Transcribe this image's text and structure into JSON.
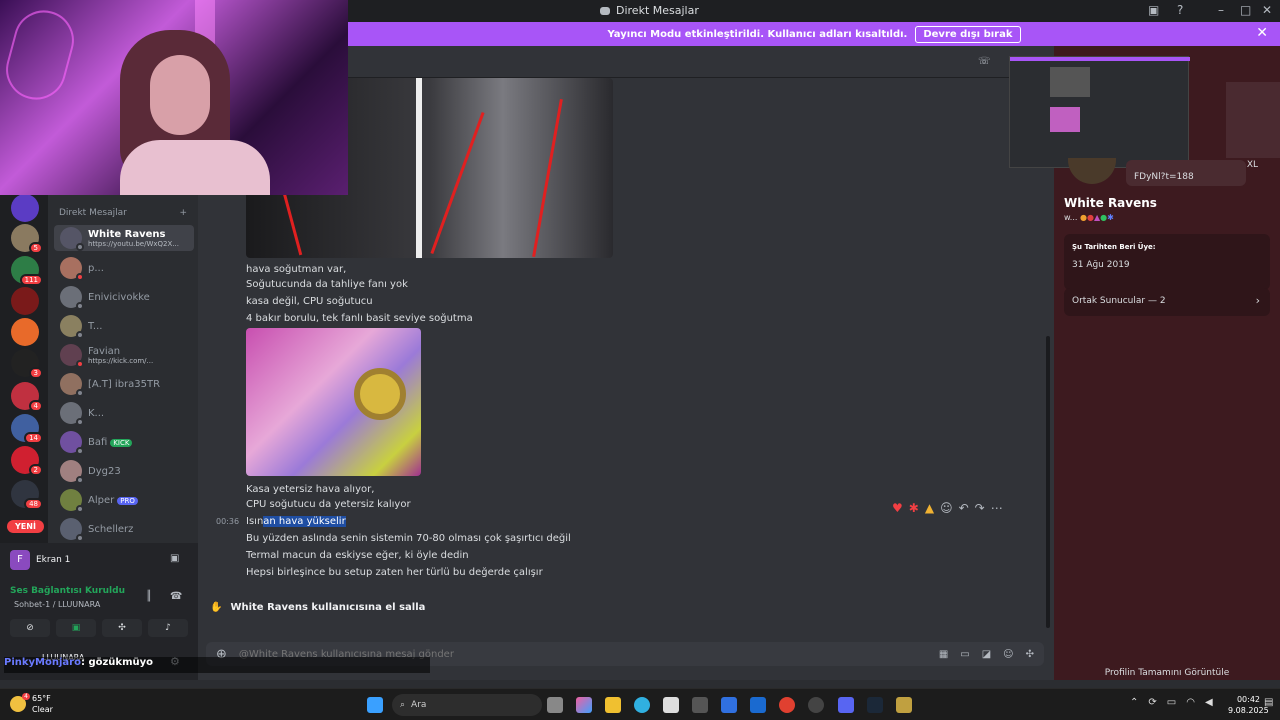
{
  "titlebar": {
    "title": "Direkt Mesajlar"
  },
  "banner": {
    "text": "Yayıncı Modu etkinleştirildi. Kullanıcı adları kısaltıldı.",
    "button": "Devre dışı bırak"
  },
  "rail": {
    "badges": [
      "5",
      "111",
      "3",
      "4",
      "14",
      "2",
      "48"
    ],
    "new_label": "YENİ"
  },
  "dm": {
    "header": "Direkt Mesajlar",
    "items": [
      {
        "name": "White Ravens",
        "sub": "https://youtu.be/WxQ2X..."
      },
      {
        "name": "p..."
      },
      {
        "name": "Enivicivokke"
      },
      {
        "name": "T..."
      },
      {
        "name": "Favian",
        "sub": "https://kick.com/..."
      },
      {
        "name": "[A.T] ibra35TR"
      },
      {
        "name": "K..."
      },
      {
        "name": "Bafi",
        "tag": "KICK"
      },
      {
        "name": "Dyg23"
      },
      {
        "name": "Alper",
        "tag": "PRO"
      },
      {
        "name": "Schellerz"
      }
    ]
  },
  "voice": {
    "screen_label": "Ekran 1",
    "status": "Ses Bağlantısı Kuruldu",
    "channel": "Sohbet-1 / LLUUNARA",
    "user": "LLUUNARA",
    "overlay_name": "PinkyMonjaro",
    "overlay_text": ": gözükmüyo"
  },
  "chat": {
    "messages1": [
      "hava soğutman var,",
      "Soğutucunda da tahliye fanı yok",
      "kasa değil, CPU soğutucu",
      "4 bakır borulu, tek fanlı basit seviye soğutma"
    ],
    "messages2": [
      "Kasa yetersiz hava alıyor,",
      "CPU soğutucu da yetersiz kalıyor"
    ],
    "time": "00:36",
    "msg_hl_pre": "Isın",
    "msg_hl": "an hava yükselir",
    "messages3": [
      "Bu yüzden aslında senin sistemin 70-80 olması çok şaşırtıcı değil",
      "Termal macun da eskiyse eğer, ki öyle dedin",
      "Hepsi birleşince bu setup zaten her türlü bu değerde çalışır"
    ],
    "wave": "White Ravens kullanıcısına el salla",
    "input_placeholder": "@White Ravens kullanıcısına mesaj gönder"
  },
  "profile": {
    "name": "White Ravens",
    "name_short": "w...",
    "link": "FDyNl?t=188",
    "link_suffix": "XL",
    "member_since_label": "Şu Tarihten Beri Üye:",
    "member_since": "31 Ağu 2019",
    "mutual_servers": "Ortak Sunucular — 2",
    "view_full": "Profilin Tamamını Görüntüle"
  },
  "taskbar": {
    "weather_temp": "65°F",
    "weather_desc": "Clear",
    "weather_badge": "4",
    "search": "Ara",
    "time": "00:42",
    "date": "9.08.2025"
  }
}
